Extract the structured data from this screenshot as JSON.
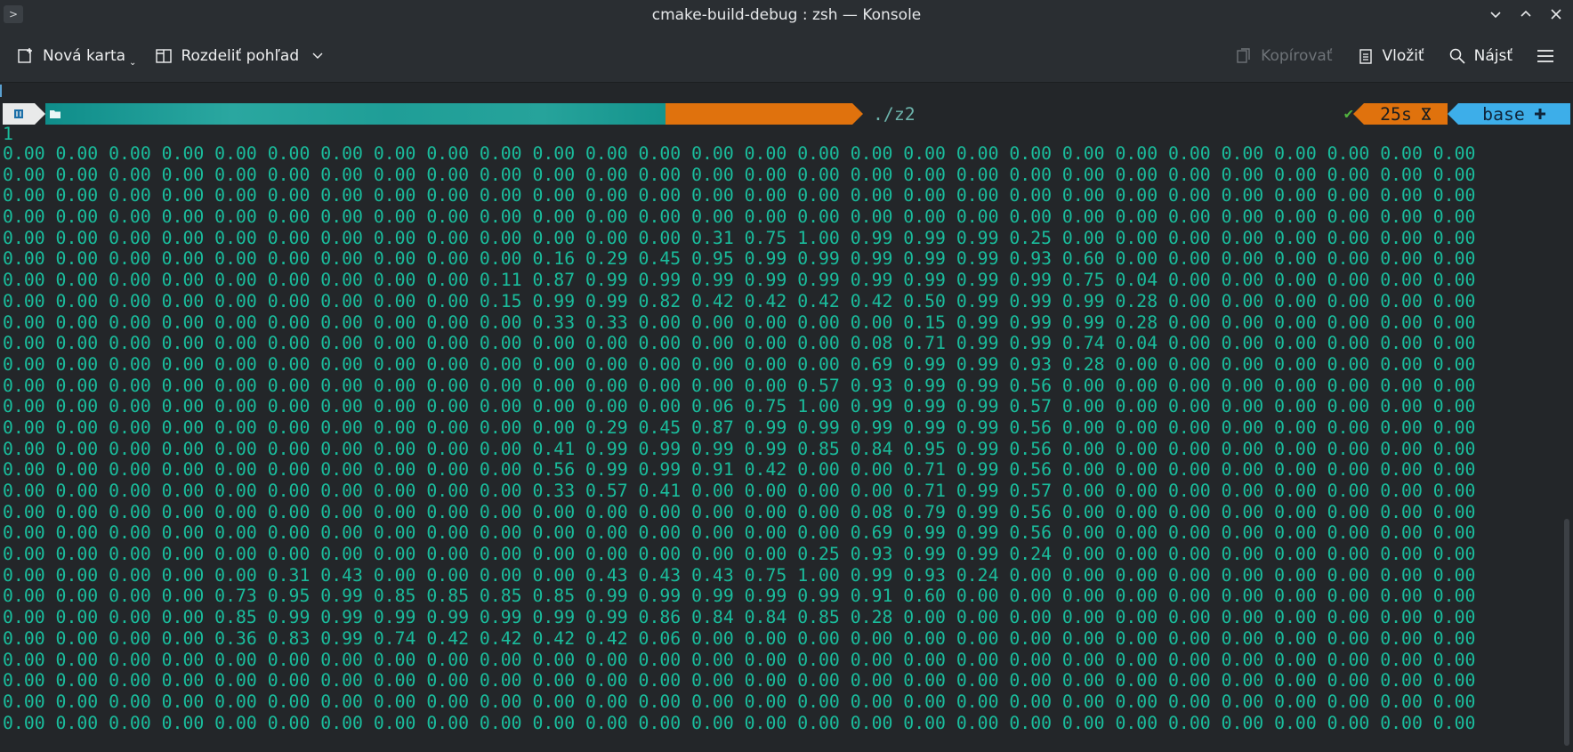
{
  "window": {
    "title": "cmake-build-debug : zsh — Konsole",
    "menu_glyph": ">"
  },
  "toolbar": {
    "new_tab": "Nová karta",
    "split_view": "Rozdeliť pohľad",
    "copy": "Kopírovať",
    "paste": "Vložiť",
    "find": "Nájsť"
  },
  "prompt": {
    "command": "./z2",
    "status_check": "✔",
    "duration": "25s",
    "env": "base"
  },
  "output": {
    "first_line": "1",
    "matrix": [
      "0.00 0.00 0.00 0.00 0.00 0.00 0.00 0.00 0.00 0.00 0.00 0.00 0.00 0.00 0.00 0.00 0.00 0.00 0.00 0.00 0.00 0.00 0.00 0.00 0.00 0.00 0.00 0.00",
      "0.00 0.00 0.00 0.00 0.00 0.00 0.00 0.00 0.00 0.00 0.00 0.00 0.00 0.00 0.00 0.00 0.00 0.00 0.00 0.00 0.00 0.00 0.00 0.00 0.00 0.00 0.00 0.00",
      "0.00 0.00 0.00 0.00 0.00 0.00 0.00 0.00 0.00 0.00 0.00 0.00 0.00 0.00 0.00 0.00 0.00 0.00 0.00 0.00 0.00 0.00 0.00 0.00 0.00 0.00 0.00 0.00",
      "0.00 0.00 0.00 0.00 0.00 0.00 0.00 0.00 0.00 0.00 0.00 0.00 0.00 0.00 0.00 0.00 0.00 0.00 0.00 0.00 0.00 0.00 0.00 0.00 0.00 0.00 0.00 0.00",
      "0.00 0.00 0.00 0.00 0.00 0.00 0.00 0.00 0.00 0.00 0.00 0.00 0.00 0.31 0.75 1.00 0.99 0.99 0.99 0.25 0.00 0.00 0.00 0.00 0.00 0.00 0.00 0.00",
      "0.00 0.00 0.00 0.00 0.00 0.00 0.00 0.00 0.00 0.00 0.16 0.29 0.45 0.95 0.99 0.99 0.99 0.99 0.99 0.93 0.60 0.00 0.00 0.00 0.00 0.00 0.00 0.00",
      "0.00 0.00 0.00 0.00 0.00 0.00 0.00 0.00 0.00 0.11 0.87 0.99 0.99 0.99 0.99 0.99 0.99 0.99 0.99 0.99 0.75 0.04 0.00 0.00 0.00 0.00 0.00 0.00",
      "0.00 0.00 0.00 0.00 0.00 0.00 0.00 0.00 0.00 0.15 0.99 0.99 0.82 0.42 0.42 0.42 0.42 0.50 0.99 0.99 0.99 0.28 0.00 0.00 0.00 0.00 0.00 0.00",
      "0.00 0.00 0.00 0.00 0.00 0.00 0.00 0.00 0.00 0.00 0.33 0.33 0.00 0.00 0.00 0.00 0.00 0.15 0.99 0.99 0.99 0.28 0.00 0.00 0.00 0.00 0.00 0.00",
      "0.00 0.00 0.00 0.00 0.00 0.00 0.00 0.00 0.00 0.00 0.00 0.00 0.00 0.00 0.00 0.00 0.08 0.71 0.99 0.99 0.74 0.04 0.00 0.00 0.00 0.00 0.00 0.00",
      "0.00 0.00 0.00 0.00 0.00 0.00 0.00 0.00 0.00 0.00 0.00 0.00 0.00 0.00 0.00 0.00 0.69 0.99 0.99 0.93 0.28 0.00 0.00 0.00 0.00 0.00 0.00 0.00",
      "0.00 0.00 0.00 0.00 0.00 0.00 0.00 0.00 0.00 0.00 0.00 0.00 0.00 0.00 0.00 0.57 0.93 0.99 0.99 0.56 0.00 0.00 0.00 0.00 0.00 0.00 0.00 0.00",
      "0.00 0.00 0.00 0.00 0.00 0.00 0.00 0.00 0.00 0.00 0.00 0.00 0.00 0.06 0.75 1.00 0.99 0.99 0.99 0.57 0.00 0.00 0.00 0.00 0.00 0.00 0.00 0.00",
      "0.00 0.00 0.00 0.00 0.00 0.00 0.00 0.00 0.00 0.00 0.00 0.29 0.45 0.87 0.99 0.99 0.99 0.99 0.99 0.56 0.00 0.00 0.00 0.00 0.00 0.00 0.00 0.00",
      "0.00 0.00 0.00 0.00 0.00 0.00 0.00 0.00 0.00 0.00 0.41 0.99 0.99 0.99 0.99 0.85 0.84 0.95 0.99 0.56 0.00 0.00 0.00 0.00 0.00 0.00 0.00 0.00",
      "0.00 0.00 0.00 0.00 0.00 0.00 0.00 0.00 0.00 0.00 0.56 0.99 0.99 0.91 0.42 0.00 0.00 0.71 0.99 0.56 0.00 0.00 0.00 0.00 0.00 0.00 0.00 0.00",
      "0.00 0.00 0.00 0.00 0.00 0.00 0.00 0.00 0.00 0.00 0.33 0.57 0.41 0.00 0.00 0.00 0.00 0.71 0.99 0.57 0.00 0.00 0.00 0.00 0.00 0.00 0.00 0.00",
      "0.00 0.00 0.00 0.00 0.00 0.00 0.00 0.00 0.00 0.00 0.00 0.00 0.00 0.00 0.00 0.00 0.08 0.79 0.99 0.56 0.00 0.00 0.00 0.00 0.00 0.00 0.00 0.00",
      "0.00 0.00 0.00 0.00 0.00 0.00 0.00 0.00 0.00 0.00 0.00 0.00 0.00 0.00 0.00 0.00 0.69 0.99 0.99 0.56 0.00 0.00 0.00 0.00 0.00 0.00 0.00 0.00",
      "0.00 0.00 0.00 0.00 0.00 0.00 0.00 0.00 0.00 0.00 0.00 0.00 0.00 0.00 0.00 0.25 0.93 0.99 0.99 0.24 0.00 0.00 0.00 0.00 0.00 0.00 0.00 0.00",
      "0.00 0.00 0.00 0.00 0.00 0.31 0.43 0.00 0.00 0.00 0.00 0.43 0.43 0.43 0.75 1.00 0.99 0.93 0.24 0.00 0.00 0.00 0.00 0.00 0.00 0.00 0.00 0.00",
      "0.00 0.00 0.00 0.00 0.73 0.95 0.99 0.85 0.85 0.85 0.85 0.99 0.99 0.99 0.99 0.99 0.91 0.60 0.00 0.00 0.00 0.00 0.00 0.00 0.00 0.00 0.00 0.00",
      "0.00 0.00 0.00 0.00 0.85 0.99 0.99 0.99 0.99 0.99 0.99 0.99 0.86 0.84 0.84 0.85 0.28 0.00 0.00 0.00 0.00 0.00 0.00 0.00 0.00 0.00 0.00 0.00",
      "0.00 0.00 0.00 0.00 0.36 0.83 0.99 0.74 0.42 0.42 0.42 0.42 0.06 0.00 0.00 0.00 0.00 0.00 0.00 0.00 0.00 0.00 0.00 0.00 0.00 0.00 0.00 0.00",
      "0.00 0.00 0.00 0.00 0.00 0.00 0.00 0.00 0.00 0.00 0.00 0.00 0.00 0.00 0.00 0.00 0.00 0.00 0.00 0.00 0.00 0.00 0.00 0.00 0.00 0.00 0.00 0.00",
      "0.00 0.00 0.00 0.00 0.00 0.00 0.00 0.00 0.00 0.00 0.00 0.00 0.00 0.00 0.00 0.00 0.00 0.00 0.00 0.00 0.00 0.00 0.00 0.00 0.00 0.00 0.00 0.00",
      "0.00 0.00 0.00 0.00 0.00 0.00 0.00 0.00 0.00 0.00 0.00 0.00 0.00 0.00 0.00 0.00 0.00 0.00 0.00 0.00 0.00 0.00 0.00 0.00 0.00 0.00 0.00 0.00",
      "0.00 0.00 0.00 0.00 0.00 0.00 0.00 0.00 0.00 0.00 0.00 0.00 0.00 0.00 0.00 0.00 0.00 0.00 0.00 0.00 0.00 0.00 0.00 0.00 0.00 0.00 0.00 0.00"
    ]
  },
  "colors": {
    "terminal_text": "#1abc9c",
    "prompt_dir": "#1f9e97",
    "prompt_git": "#e0720d",
    "prompt_env": "#3daee9"
  }
}
